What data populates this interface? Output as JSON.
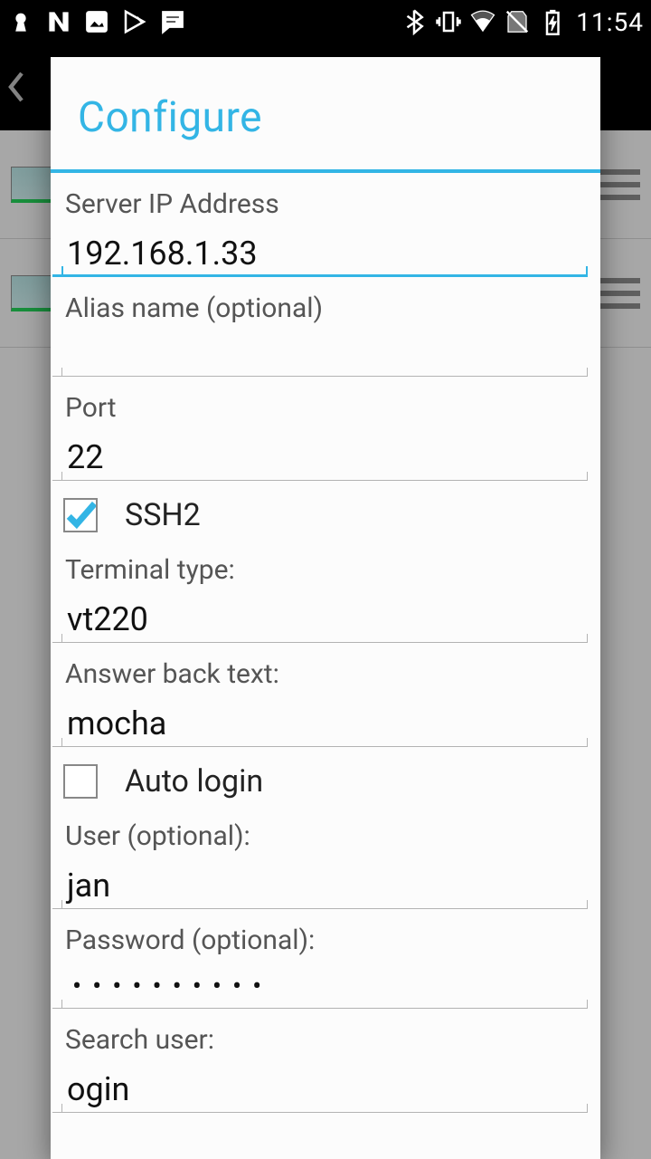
{
  "status": {
    "clock": "11:54"
  },
  "dialog": {
    "title": "Configure",
    "fields": {
      "server_ip_label": "Server IP Address",
      "server_ip_value": "192.168.1.33",
      "alias_label": "Alias name (optional)",
      "alias_value": "",
      "port_label": "Port",
      "port_value": "22",
      "ssh2_label": "SSH2",
      "ssh2_checked": true,
      "terminal_type_label": "Terminal type:",
      "terminal_type_value": "vt220",
      "answer_back_label": "Answer back text:",
      "answer_back_value": "mocha",
      "auto_login_label": "Auto login",
      "auto_login_checked": false,
      "user_label": "User (optional):",
      "user_value": "jan",
      "password_label": "Password (optional):",
      "password_masked": "••••••••••",
      "search_user_label": "Search user:",
      "search_user_value": "ogin"
    }
  }
}
